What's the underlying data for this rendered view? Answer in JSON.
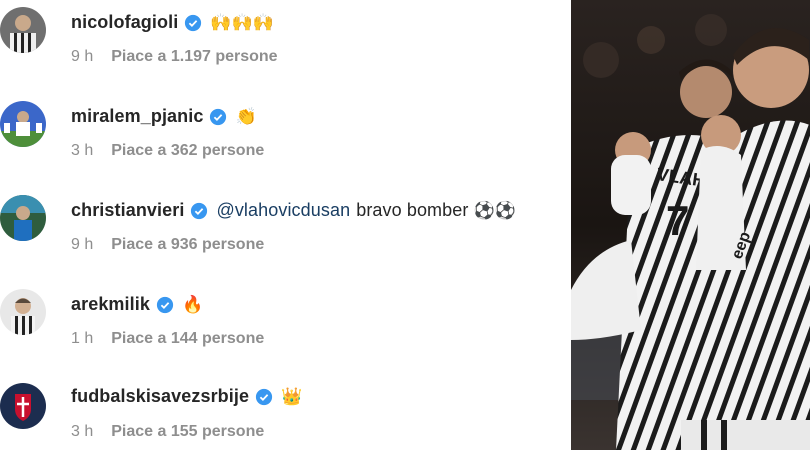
{
  "comments": [
    {
      "username": "nicolofagioli",
      "verified": true,
      "text": "",
      "mention": "",
      "emoji": "🙌🙌🙌",
      "time": "9 h",
      "likes": "Piace a 1.197 persone"
    },
    {
      "username": "miralem_pjanic",
      "verified": true,
      "text": "",
      "mention": "",
      "emoji": "👏",
      "time": "3 h",
      "likes": "Piace a 362 persone"
    },
    {
      "username": "christianvieri",
      "verified": true,
      "text": "bravo bomber",
      "mention": "@vlahovicdusan",
      "emoji": "⚽⚽",
      "time": "9 h",
      "likes": "Piace a 936 persone"
    },
    {
      "username": "arekmilik",
      "verified": true,
      "text": "",
      "mention": "",
      "emoji": "🔥",
      "time": "1 h",
      "likes": "Piace a 144 persone"
    },
    {
      "username": "fudbalskisavezsrbije",
      "verified": true,
      "text": "",
      "mention": "",
      "emoji": "👑",
      "time": "3 h",
      "likes": "Piace a 155 persone"
    }
  ],
  "colors": {
    "verified": "#3897f0",
    "username": "#262626",
    "meta": "#8e8e8e",
    "mention": "#1a3e63"
  }
}
